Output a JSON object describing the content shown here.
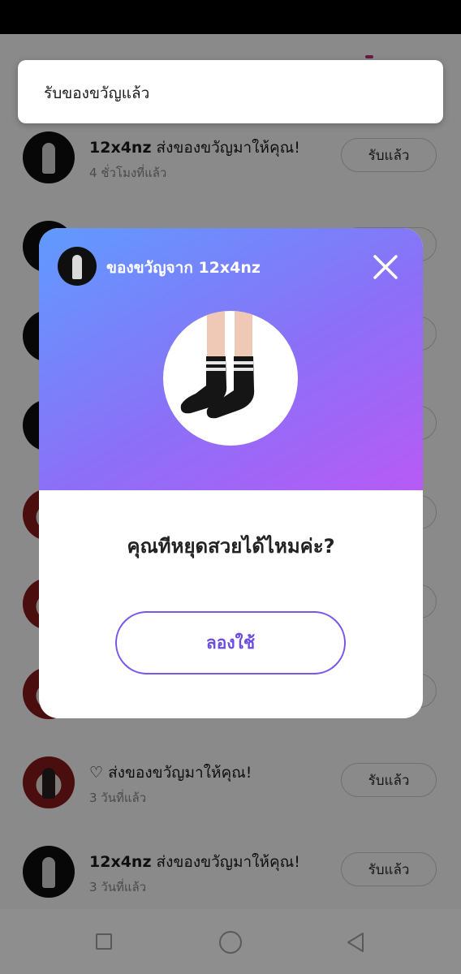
{
  "toast": {
    "text": "รับของขวัญแล้ว"
  },
  "rows": [
    {
      "name": "12x4nz",
      "message": " ส่งของขวัญมาให้คุณ!",
      "time": "4 ชั่วโมงที่แล้ว",
      "button": "รับแล้ว",
      "avatar": "dark"
    },
    {
      "name": "",
      "message": "",
      "time": "",
      "button": "",
      "avatar": "dark"
    },
    {
      "name": "",
      "message": "",
      "time": "",
      "button": "",
      "avatar": "dark"
    },
    {
      "name": "",
      "message": "",
      "time": "",
      "button": "",
      "avatar": "dark"
    },
    {
      "name": "",
      "message": "",
      "time": "",
      "button": "",
      "avatar": "light"
    },
    {
      "name": "",
      "message": "",
      "time": "",
      "button": "",
      "avatar": "light"
    },
    {
      "name": "",
      "message": "",
      "time": "",
      "button": "",
      "avatar": "light"
    },
    {
      "name": "",
      "message": "♡ ส่งของขวัญมาให้คุณ!",
      "time": "3 วันที่แล้ว",
      "button": "รับแล้ว",
      "avatar": "light"
    },
    {
      "name": "12x4nz",
      "message": " ส่งของขวัญมาให้คุณ!",
      "time": "3 วันที่แล้ว",
      "button": "รับแล้ว",
      "avatar": "dark"
    }
  ],
  "modal": {
    "title": "ของขวัญจาก 12x4nz",
    "question": "คุณทีหยุดสวยได้ไหมค่ะ?",
    "try_button": "ลองใช้",
    "gift_icon": "black-socks-icon",
    "gradient_start": "#5f9bff",
    "gradient_end": "#b75af6",
    "accent": "#6d4de0"
  },
  "nav": {
    "recent": "recent-apps-icon",
    "home": "home-icon",
    "back": "back-icon"
  }
}
